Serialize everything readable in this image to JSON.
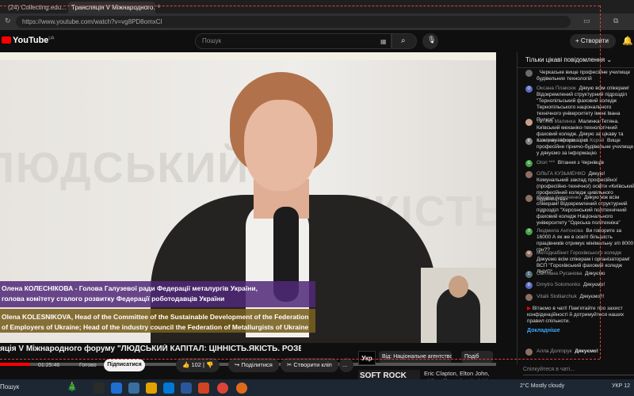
{
  "browser": {
    "tabs": [
      "(24) Collecting.edu...",
      "Трансляція V Міжнародного..."
    ],
    "url": "https://www.youtube.com/watch?v=vg8PD8omxCI"
  },
  "youtube": {
    "logo": "YouTube",
    "region": "UA",
    "search_placeholder": "Пошук",
    "create_label": "+ Створити"
  },
  "video": {
    "wall_text_1": "ЛЮДСЬКИЙ",
    "wall_text_2": "ЯКІСТЬ",
    "caption_ua_1": "Олена КОЛЕСНІКОВА - Голова Галузевої ради Федерації металургів України,",
    "caption_ua_2": "голова комітету сталого розвитку Федерації роботодавців України",
    "caption_en_1": "Olena KOLESNIKOVA, Head of the Committee of the Sustainable Development of the Federation",
    "caption_en_2": "of Employers of Ukraine; Head of the industry council the Federation of Metallurgists of Ukraine",
    "progress_percent": 6,
    "time": "01:25:46",
    "ready": "Готово"
  },
  "below": {
    "title": "яція V Міжнародного форуму \"ЛЮДСЬКИЙ КАПІТАЛ: ЦІННІСТЬ.ЯКІСТЬ. РОЗВИТОК\"",
    "subscribe": "Підписатися",
    "likes": "102",
    "share": "Поділитися",
    "clip": "Створити кліп",
    "more": "...",
    "channel_badge": "Укр",
    "filter_1": "Від: Національне агентство",
    "filter_2": "Подіб",
    "thumb_text": "SOFT ROCK",
    "thumb_caption": "Eric Clapton, Elton John, Phil Collins, Lionel Richie, Bee Gee"
  },
  "chat": {
    "header": "Тільки цікаві повідомлення ⌄",
    "messages": [
      {
        "avatar": "",
        "color": "#6b6b6b",
        "name": "",
        "text": "Черкаське вище професійне училище будівельних технологій"
      },
      {
        "avatar": "О",
        "color": "#5c6bc0",
        "name": "Оксана Плаксюк",
        "text": "Дякую всім спікерам! Відокремлений структурний підрозділ \"Тернопільський фаховий коледж Тернопільського національного технічного університету імені Івана Пулюя\""
      },
      {
        "avatar": "",
        "color": "#c6a08a",
        "name": "Тетяна Малинка",
        "text": "Малинка Тетяна. Київський механіко-технологічний фаховий коледж. Дякую за цікаву та важливу інформацію!"
      },
      {
        "avatar": "К",
        "color": "#7e7e7e",
        "name": "Катерина Миколаївна Корой",
        "text": "Вище професійне гірничо-будівельне училище у дякуємо за інформацію"
      },
      {
        "avatar": "G",
        "color": "#43a047",
        "name": "Glori ***",
        "text": "Вітання з Чернівців"
      },
      {
        "avatar": "",
        "color": "#8d6e63",
        "name": "ОЛЬГА КУЗЬМЕНКО",
        "text": "Дякую! Комунальний заклад професійної (професійно-технічної) освіти «Київський професійний коледж цивільного будівництва»"
      },
      {
        "avatar": "",
        "color": "#8d6e63",
        "name": "Оксана Комоченко",
        "text": "Дякую ніж всім спікерам! Відокремлений структурний підрозділ \"Херсонський політехнічний фаховий коледж Національного університету \"Одеська політехніка\""
      },
      {
        "avatar": "Л",
        "color": "#43a047",
        "name": "Людмила Антонова",
        "text": "Ви говорите за 16000 А як же в освіті більшість працівників отримує мінімальну з/п 8000 грн??"
      },
      {
        "avatar": "М",
        "color": "#8d6e63",
        "name": "Методкабінет Горохівського коледж",
        "text": "Дякуємо всім спікерам і організаторам! ВСП \"Горохівський фаховий коледж ЛНУП\""
      },
      {
        "avatar": "С",
        "color": "#546e7a",
        "name": "Світлана Русанова",
        "text": "Дякуємо"
      },
      {
        "avatar": "D",
        "color": "#5c6bc0",
        "name": "Dmytro Solomonko",
        "text": "Дякуємо!"
      },
      {
        "avatar": "",
        "color": "#8d6e63",
        "name": "Vitalii Stolliarchuk",
        "text": "Дякуємо!!!"
      }
    ],
    "notice": "Вітаємо в чаті! Пам'ятайте про захист конфіденційності й дотримуйтеся наших правил спільноти.",
    "notice_link": "Докладніше",
    "last_name": "Алла Долгорук",
    "last_text": "Дякуємо!",
    "input_placeholder": "Спілкуйтеся в чаті..."
  },
  "taskbar": {
    "search": "Пошук",
    "weather": "2°C  Mostly cloudy",
    "lang": "УКР",
    "time": "12"
  }
}
